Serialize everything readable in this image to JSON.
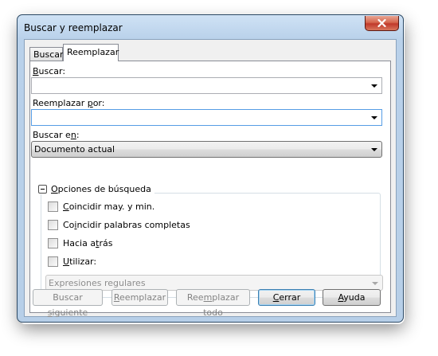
{
  "window": {
    "title": "Buscar y reemplazar"
  },
  "tabs": [
    {
      "label": "Buscar",
      "selected": false
    },
    {
      "label": "Reemplazar",
      "selected": true
    }
  ],
  "find": {
    "label_prefix": "",
    "label_key": "B",
    "label_rest": "uscar:",
    "value": ""
  },
  "replace": {
    "label_prefix": "Reemplazar ",
    "label_key": "p",
    "label_rest": "or:",
    "value": ""
  },
  "look_in": {
    "label_prefix": "Buscar e",
    "label_key": "n",
    "label_rest": ":",
    "value": "Documento actual"
  },
  "options": {
    "header_key": "O",
    "header_rest": "pciones de búsqueda",
    "items": [
      {
        "prefix": "",
        "key": "C",
        "rest": "oincidir may. y min.",
        "checked": false
      },
      {
        "prefix": "Co",
        "key": "i",
        "rest": "ncidir palabras completas",
        "checked": false
      },
      {
        "prefix": "Hacia a",
        "key": "t",
        "rest": "rás",
        "checked": false
      },
      {
        "prefix": "",
        "key": "U",
        "rest": "tilizar:",
        "checked": false
      }
    ],
    "use_value": "Expresiones regulares"
  },
  "buttons": {
    "find_next": {
      "prefix": "Buscar ",
      "key": "s",
      "rest": "iguiente"
    },
    "replace": {
      "prefix": "",
      "key": "R",
      "rest": "eemplazar"
    },
    "replace_all": {
      "prefix": "Ree",
      "key": "m",
      "rest": "plazar todo"
    },
    "close": {
      "prefix": "",
      "key": "C",
      "rest": "errar"
    },
    "help": {
      "prefix": "",
      "key": "A",
      "rest": "yuda"
    }
  },
  "colors": {
    "close_button": "#c0392b",
    "focus_border": "#569de5",
    "frame": "#b9d1ea"
  },
  "icons": {
    "close": "close-x-icon",
    "dropdown": "chevron-down-icon",
    "collapse": "collapse-minus-icon"
  }
}
